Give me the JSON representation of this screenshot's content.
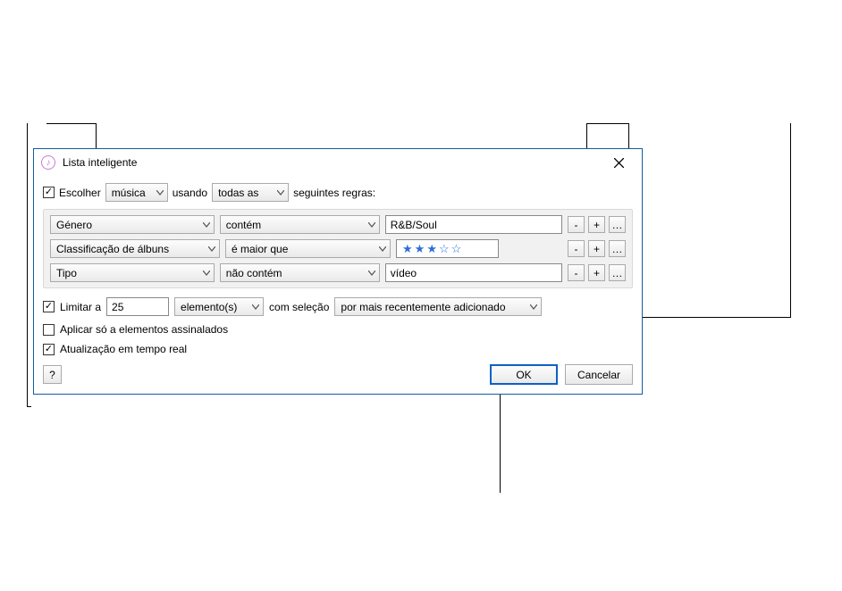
{
  "dialog": {
    "title": "Lista inteligente",
    "match": {
      "chooseLabel": "Escolher",
      "source": "música",
      "usingLabel": "usando",
      "scope": "todas as",
      "suffix": "seguintes regras:"
    },
    "rules": [
      {
        "field": "Género",
        "op": "contém",
        "valueType": "text",
        "value": "R&B/Soul"
      },
      {
        "field": "Classificação de álbuns",
        "op": "é maior que",
        "valueType": "stars",
        "stars": 3,
        "maxStars": 5
      },
      {
        "field": "Tipo",
        "op": "não contém",
        "valueType": "text",
        "value": "vídeo"
      }
    ],
    "ruleButtons": {
      "remove": "-",
      "add": "+",
      "more": "…"
    },
    "limit": {
      "label": "Limitar a",
      "value": "25",
      "unit": "elemento(s)",
      "selectedByLabel": "com seleção",
      "selectedBy": "por mais recentemente adicionado"
    },
    "options": {
      "onlyChecked": "Aplicar só a elementos assinalados",
      "liveUpdate": "Atualização em tempo real"
    },
    "buttons": {
      "help": "?",
      "ok": "OK",
      "cancel": "Cancelar"
    }
  }
}
